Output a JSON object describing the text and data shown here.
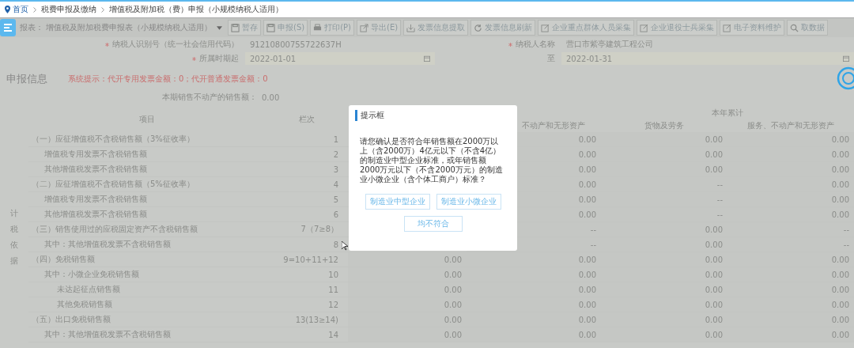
{
  "breadcrumb": [
    {
      "label": "首页",
      "kind": "home"
    },
    {
      "label": "税费申报及缴纳",
      "kind": "link"
    },
    {
      "label": "增值税及附加税（费）申报（小规模纳税人适用）",
      "kind": "current"
    }
  ],
  "toolbar": {
    "report_label": "报表：",
    "report_select": "增值税及附加税费申报表（小规模纳税人适用）",
    "buttons": [
      {
        "label": "暂存",
        "kind": "save"
      },
      {
        "label": "申报(S)",
        "kind": "save"
      },
      {
        "label": "打印(P)",
        "kind": "print"
      },
      {
        "label": "导出(E)",
        "kind": "export"
      },
      {
        "label": "发票信息提取",
        "kind": "download"
      },
      {
        "label": "发票信息刷新",
        "kind": "refresh"
      },
      {
        "label": "企业重点群体人员采集",
        "kind": "edit"
      },
      {
        "label": "企业退役士兵采集",
        "kind": "edit"
      },
      {
        "label": "电子资料维护",
        "kind": "edit"
      },
      {
        "label": "取数据",
        "kind": "search"
      }
    ]
  },
  "taxpayer_rows": [
    {
      "fields": [
        {
          "label": "纳税人识别号（统一社会信用代码）",
          "value": "91210800755722637H",
          "required": true,
          "kind": "text"
        },
        {
          "label": "纳税人名称",
          "value": "营口市紫亭建筑工程公司",
          "required": true,
          "kind": "text"
        }
      ]
    },
    {
      "fields": [
        {
          "label": "所属时期起",
          "value": "2022-01-01",
          "required": true,
          "kind": "date"
        },
        {
          "label": "至",
          "value": "2022-01-31",
          "required": false,
          "kind": "date"
        }
      ]
    }
  ],
  "declaration": {
    "title": "申报信息",
    "notice": "系统提示：代开专用发票金额：0；代开普通发票金额：0",
    "sales_label": "本期销售不动产的销售额：",
    "sales_value": "0.00"
  },
  "table": {
    "side_label": "计税依据",
    "headers": {
      "item": "项目",
      "line": "栏次",
      "year_total": "本年累计",
      "column_4": "不动产和无形资产",
      "column_5": "货物及劳务",
      "column_6": "服务、不动产和无形资产"
    },
    "rows": [
      {
        "item": "（一）应征增值税不含税销售额（3%征收率）",
        "line": "1",
        "values": [
          "0.00",
          "0.00",
          "0.00"
        ],
        "children": [
          {
            "item": "增值税专用发票不含税销售额",
            "line": "2",
            "values": [
              "0.00",
              "0.00",
              "0.00"
            ]
          },
          {
            "item": "其他增值税发票不含税销售额",
            "line": "3",
            "values": [
              "0.00",
              "0.00",
              "0.00"
            ]
          }
        ]
      },
      {
        "item": "（二）应征增值税不含税销售额（5%征收率）",
        "line": "4",
        "values": [
          "0.00",
          "--",
          "0.00"
        ],
        "children": [
          {
            "item": "增值税专用发票不含税销售额",
            "line": "5",
            "values": [
              "0.00",
              "--",
              "0.00"
            ]
          },
          {
            "item": "其他增值税发票不含税销售额",
            "line": "6",
            "values": [
              "0.00",
              "--",
              "0.00"
            ]
          }
        ]
      },
      {
        "item": "（三）销售使用过的应税固定资产不含税销售额",
        "line": "7（7≥8）",
        "values": [
          "--",
          "0.00",
          "--"
        ],
        "children": [
          {
            "item": "其中：其他增值税发票不含税销售额",
            "line": "8",
            "values": [
              "--",
              "0.00",
              "--"
            ]
          }
        ]
      },
      {
        "item": "（四）免税销售额",
        "line": "9=10+11+12",
        "values": [
          "0.00",
          "0.00",
          "0.00",
          "0.00"
        ],
        "children": [
          {
            "item": "其中：小微企业免税销售额",
            "line": "10",
            "values": [
              "0.00",
              "0.00",
              "0.00",
              "0.00"
            ],
            "children": [
              {
                "item": "未达起征点销售额",
                "line": "11",
                "values": [
                  "0.00",
                  "0.00",
                  "0.00",
                  "0.00"
                ]
              },
              {
                "item": "其他免税销售额",
                "line": "12",
                "values": [
                  "0.00",
                  "0.00",
                  "0.00",
                  "0.00"
                ]
              }
            ]
          }
        ]
      },
      {
        "item": "（五）出口免税销售额",
        "line": "13(13≥14)",
        "values": [
          "0.00",
          "0.00",
          "0.00",
          "0.00"
        ],
        "children": [
          {
            "item": "其中：其他增值税发票不含税销售额",
            "line": "14",
            "values": [
              "0.00",
              "0.00",
              "0.00",
              "0.00"
            ]
          }
        ]
      }
    ]
  },
  "dialog": {
    "title": "提示框",
    "message": "请您确认是否符合年销售额在2000万以上（含2000万）4亿元以下（不含4亿）的制造业中型企业标准，或年销售额2000万元以下（不含2000万元）的制造业小微企业（含个体工商户）标准？",
    "buttons": [
      {
        "label": "制造业中型企业"
      },
      {
        "label": "制造业小微企业"
      },
      {
        "label": "均不符合"
      }
    ]
  }
}
